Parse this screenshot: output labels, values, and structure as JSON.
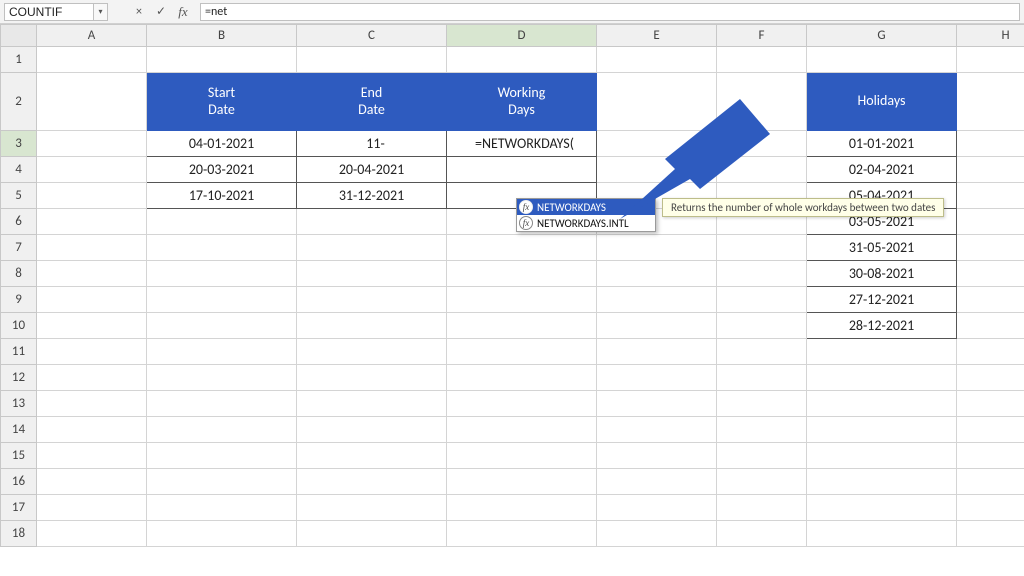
{
  "formula_bar": {
    "name_box": "COUNTIF",
    "cancel_icon": "×",
    "accept_icon": "✓",
    "fx_icon": "fx",
    "formula_text": "=net"
  },
  "columns": [
    "A",
    "B",
    "C",
    "D",
    "E",
    "F",
    "G",
    "H"
  ],
  "rows": [
    1,
    2,
    3,
    4,
    5,
    6,
    7,
    8,
    9,
    10,
    11,
    12,
    13,
    14,
    15,
    16,
    17,
    18
  ],
  "active_col": "D",
  "active_row": 3,
  "headers": {
    "start_date": "Start\nDate",
    "end_date": "End\nDate",
    "working_days": "Working\nDays",
    "holidays": "Holidays"
  },
  "table": {
    "start_dates": [
      "04-01-2021",
      "20-03-2021",
      "17-10-2021"
    ],
    "end_dates": [
      "11-",
      "20-04-2021",
      "31-12-2021"
    ],
    "working_days_formula": "=NETWORKDAYS("
  },
  "holidays": [
    "01-01-2021",
    "02-04-2021",
    "05-04-2021",
    "03-05-2021",
    "31-05-2021",
    "30-08-2021",
    "27-12-2021",
    "28-12-2021"
  ],
  "autocomplete": {
    "items": [
      "NETWORKDAYS",
      "NETWORKDAYS.INTL"
    ],
    "selected": 0,
    "tooltip": "Returns the number of whole workdays between two dates"
  },
  "arrow_color": "#2e5bbf"
}
